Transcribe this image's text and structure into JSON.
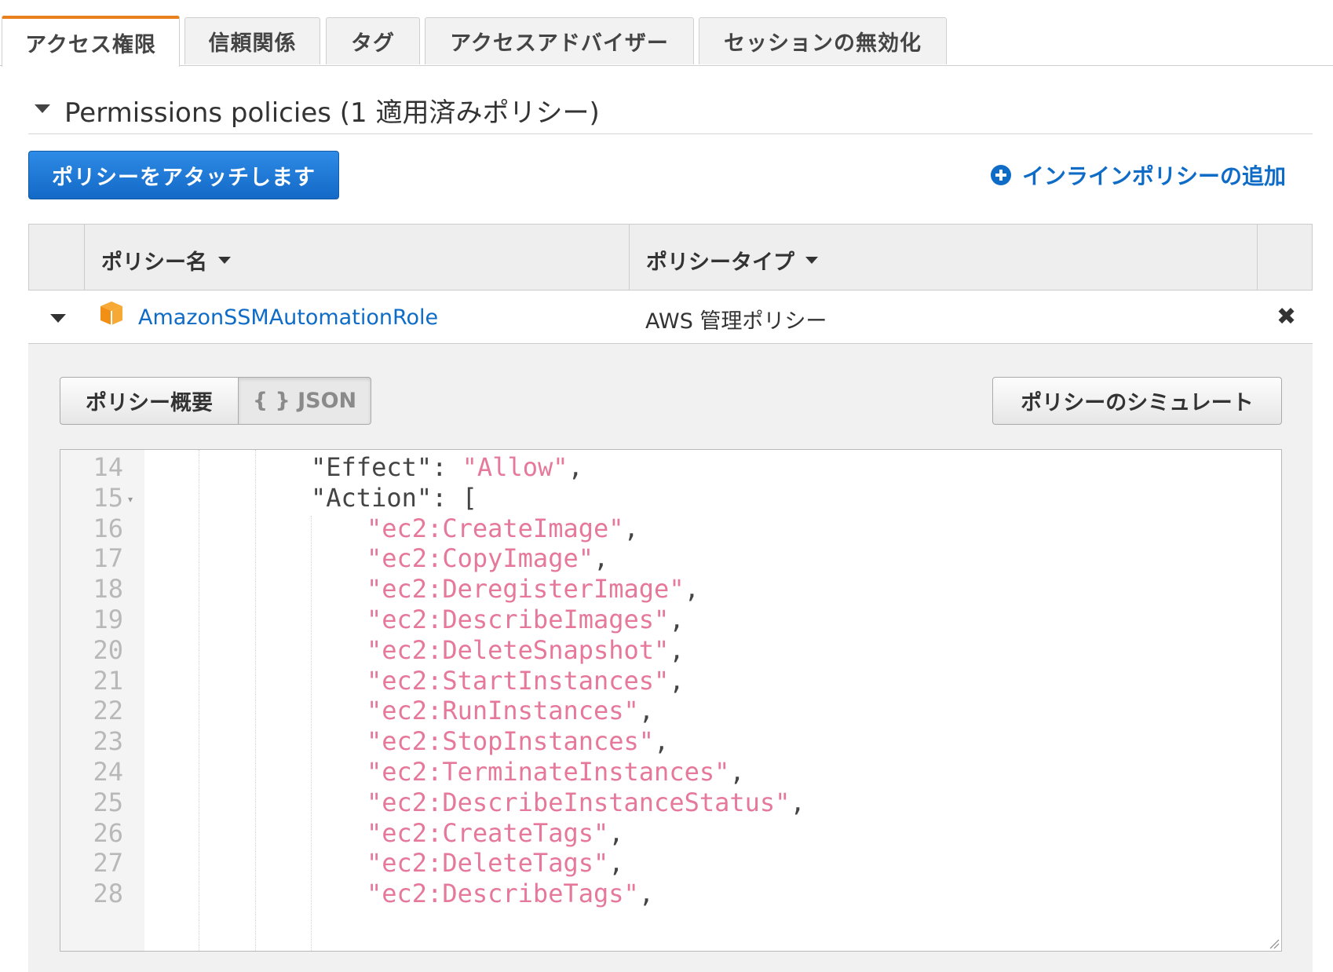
{
  "tabs": [
    {
      "label": "アクセス権限",
      "active": true
    },
    {
      "label": "信頼関係",
      "active": false
    },
    {
      "label": "タグ",
      "active": false
    },
    {
      "label": "アクセスアドバイザー",
      "active": false
    },
    {
      "label": "セッションの無効化",
      "active": false
    }
  ],
  "section": {
    "title": "Permissions policies (1 適用済みポリシー)"
  },
  "actions": {
    "attach_label": "ポリシーをアタッチします",
    "add_inline_label": "インラインポリシーの追加"
  },
  "table": {
    "columns": [
      "ポリシー名",
      "ポリシータイプ"
    ],
    "rows": [
      {
        "name": "AmazonSSMAutomationRole",
        "type": "AWS 管理ポリシー"
      }
    ]
  },
  "detail": {
    "summary_label": "ポリシー概要",
    "json_label": "{ } JSON",
    "simulate_label": "ポリシーのシミュレート"
  },
  "editor": {
    "lines": [
      {
        "num": "14",
        "key": "\"Effect\"",
        "val": "\"Allow\"",
        "tail": ","
      },
      {
        "num": "15",
        "key": "\"Action\"",
        "tail": ": ["
      },
      {
        "num": "16",
        "val": "\"ec2:CreateImage\"",
        "tail": ","
      },
      {
        "num": "17",
        "val": "\"ec2:CopyImage\"",
        "tail": ","
      },
      {
        "num": "18",
        "val": "\"ec2:DeregisterImage\"",
        "tail": ","
      },
      {
        "num": "19",
        "val": "\"ec2:DescribeImages\"",
        "tail": ","
      },
      {
        "num": "20",
        "val": "\"ec2:DeleteSnapshot\"",
        "tail": ","
      },
      {
        "num": "21",
        "val": "\"ec2:StartInstances\"",
        "tail": ","
      },
      {
        "num": "22",
        "val": "\"ec2:RunInstances\"",
        "tail": ","
      },
      {
        "num": "23",
        "val": "\"ec2:StopInstances\"",
        "tail": ","
      },
      {
        "num": "24",
        "val": "\"ec2:TerminateInstances\"",
        "tail": ","
      },
      {
        "num": "25",
        "val": "\"ec2:DescribeInstanceStatus\"",
        "tail": ","
      },
      {
        "num": "26",
        "val": "\"ec2:CreateTags\"",
        "tail": ","
      },
      {
        "num": "27",
        "val": "\"ec2:DeleteTags\"",
        "tail": ","
      },
      {
        "num": "28",
        "val": "\"ec2:DescribeTags\"",
        "tail": ","
      }
    ]
  },
  "colors": {
    "accent_tab": "#e8801e",
    "primary_button": "#1a74d4",
    "link": "#0e6cc7",
    "string": "#e6799b"
  }
}
